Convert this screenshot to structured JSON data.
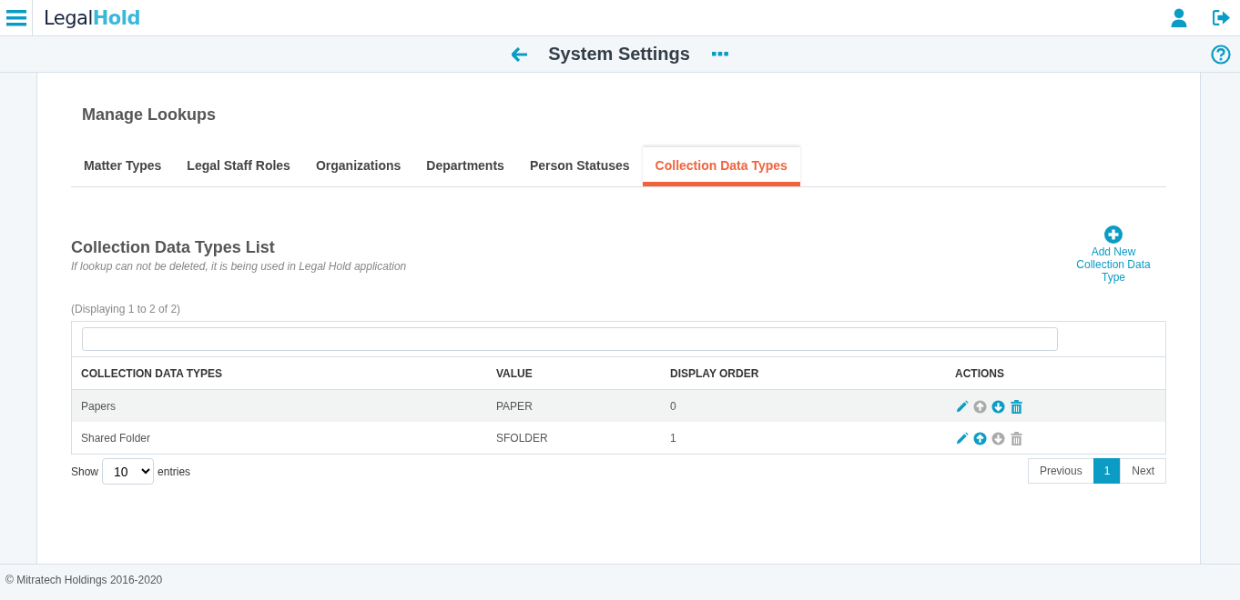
{
  "logo": {
    "text": "Legal",
    "accent": "Hold"
  },
  "page_title": "System Settings",
  "section_title": "Manage Lookups",
  "tabs": [
    {
      "label": "Matter Types",
      "selected": false
    },
    {
      "label": "Legal Staff Roles",
      "selected": false
    },
    {
      "label": "Organizations",
      "selected": false
    },
    {
      "label": "Departments",
      "selected": false
    },
    {
      "label": "Person Statuses",
      "selected": false
    },
    {
      "label": "Collection Data Types",
      "selected": true
    }
  ],
  "list": {
    "title": "Collection Data Types List",
    "note": "If lookup can not be deleted, it is being used in Legal Hold application",
    "add_button": "Add New Collection Data Type",
    "info": "(Displaying 1 to 2 of 2)"
  },
  "table": {
    "columns": [
      "COLLECTION DATA TYPES",
      "VALUE",
      "DISPLAY ORDER",
      "ACTIONS"
    ],
    "rows": [
      {
        "cells": [
          "Papers",
          "PAPER",
          "0"
        ],
        "can_move_up": false,
        "can_move_down": true,
        "can_delete": true
      },
      {
        "cells": [
          "Shared Folder",
          "SFOLDER",
          "1"
        ],
        "can_move_up": true,
        "can_move_down": false,
        "can_delete": false
      }
    ]
  },
  "length": {
    "before": "Show",
    "value": "10",
    "after": "entries"
  },
  "pagination": [
    {
      "label": "Previous",
      "selected": false
    },
    {
      "label": "1",
      "selected": true
    },
    {
      "label": "Next",
      "selected": false
    }
  ],
  "footer": "© Mitratech Holdings 2016-2020"
}
